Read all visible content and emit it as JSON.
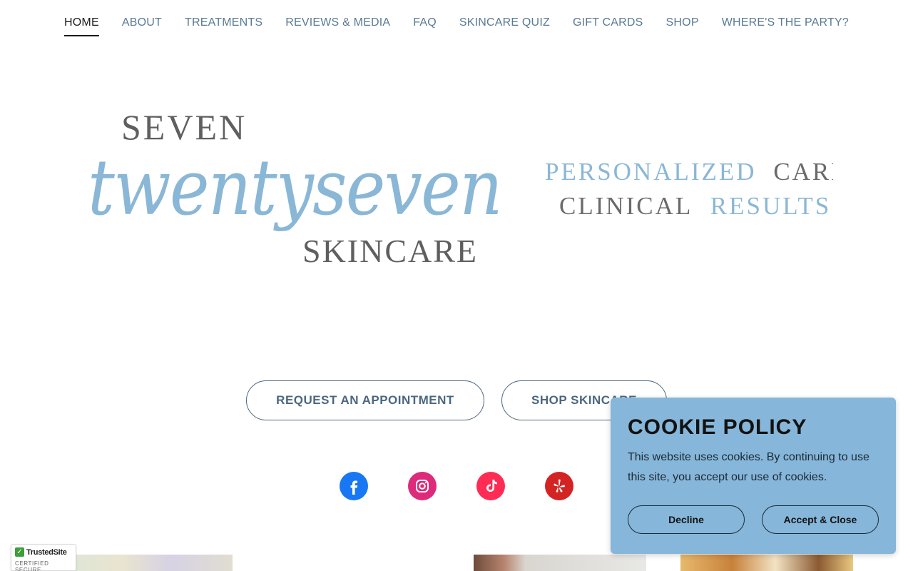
{
  "nav": {
    "items": [
      {
        "label": "HOME",
        "active": true
      },
      {
        "label": "ABOUT"
      },
      {
        "label": "TREATMENTS"
      },
      {
        "label": "REVIEWS & MEDIA"
      },
      {
        "label": "FAQ"
      },
      {
        "label": "SKINCARE QUIZ"
      },
      {
        "label": "GIFT CARDS"
      },
      {
        "label": "SHOP"
      },
      {
        "label": "WHERE'S THE PARTY?"
      }
    ]
  },
  "logo": {
    "line1": "SEVEN",
    "line2": "twentyseven",
    "line3": "SKINCARE",
    "tag1a": "PERSONALIZED",
    "tag1b": "CARE",
    "tag2a": "CLINICAL",
    "tag2b": "RESULTS"
  },
  "cta": {
    "appointment": "REQUEST AN APPOINTMENT",
    "shop": "SHOP SKINCARE"
  },
  "social": {
    "icons": [
      "facebook-icon",
      "instagram-icon",
      "tiktok-icon",
      "yelp-icon"
    ]
  },
  "trusted": {
    "name": "TrustedSite",
    "sub": "CERTIFIED SECURE"
  },
  "cookie": {
    "title": "COOKIE POLICY",
    "text": "This website uses cookies. By continuing to use this site, you accept our use of cookies.",
    "decline": "Decline",
    "accept": "Accept & Close"
  },
  "colors": {
    "accent": "#86b6d9",
    "nav_text": "#5a7a93",
    "logo_blue": "#8ab7d6",
    "logo_gray": "#5f5f5f"
  }
}
